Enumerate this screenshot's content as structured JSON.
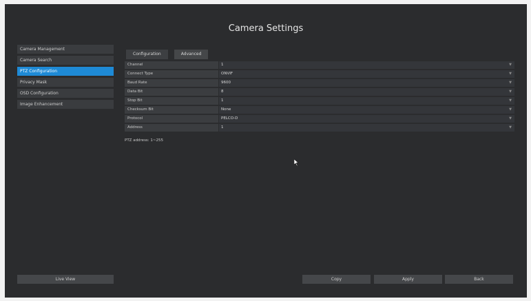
{
  "window": {
    "title": "Camera Settings"
  },
  "sidebar": {
    "items": [
      {
        "label": "Camera Management",
        "active": false
      },
      {
        "label": "Camera Search",
        "active": false
      },
      {
        "label": "PTZ Configuration",
        "active": true
      },
      {
        "label": "Privacy Mask",
        "active": false
      },
      {
        "label": "OSD Configuration",
        "active": false
      },
      {
        "label": "Image Enhancement",
        "active": false
      }
    ],
    "live_view_label": "Live View"
  },
  "tabs": [
    {
      "label": "Configuration",
      "selected": true
    },
    {
      "label": "Advanced",
      "selected": false
    }
  ],
  "form": {
    "rows": [
      {
        "label": "Channel",
        "value": "1"
      },
      {
        "label": "Connect Type",
        "value": "ONVIF"
      },
      {
        "label": "Baud Rate",
        "value": "9600"
      },
      {
        "label": "Data Bit",
        "value": "8"
      },
      {
        "label": "Stop Bit",
        "value": "1"
      },
      {
        "label": "Checksum Bit",
        "value": "None"
      },
      {
        "label": "Protocol",
        "value": "PELCO-D"
      },
      {
        "label": "Address",
        "value": "1"
      }
    ],
    "hint": "PTZ address: 1~255"
  },
  "footer": {
    "copy_label": "Copy",
    "apply_label": "Apply",
    "back_label": "Back"
  },
  "colors": {
    "background": "#2b2c2e",
    "accent": "#1e8ad6",
    "button": "#45474a"
  }
}
